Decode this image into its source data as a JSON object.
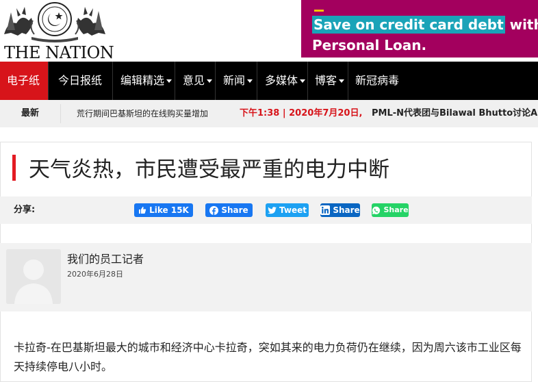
{
  "logo": {
    "text": "THE NATION"
  },
  "ad": {
    "line1_highlight": "Save on credit card debt",
    "line1_rest": " with a",
    "line2": "Personal Loan."
  },
  "nav": {
    "items": [
      {
        "label": "电子纸",
        "active": true,
        "dropdown": false
      },
      {
        "label": "今日报纸",
        "active": false,
        "dropdown": false
      },
      {
        "label": "编辑精选",
        "active": false,
        "dropdown": true
      },
      {
        "label": "意见",
        "active": false,
        "dropdown": true
      },
      {
        "label": "新闻",
        "active": false,
        "dropdown": true
      },
      {
        "label": "多媒体",
        "active": false,
        "dropdown": true
      },
      {
        "label": "博客",
        "active": false,
        "dropdown": true
      },
      {
        "label": "新冠病毒",
        "active": false,
        "dropdown": false
      }
    ]
  },
  "ticker": {
    "label": "最新",
    "item1": "荒行期间巴基斯坦的在线购买量增加",
    "time": "下午1:38 | 2020年7月20日,",
    "item2": "PML-N代表团与Bilawal Bhutto讨论APC问"
  },
  "article": {
    "title": "天气炎热，市民遭受最严重的电力中断",
    "share_label": "分享:",
    "share": {
      "fb_like": "Like 15K",
      "fb_share": "Share",
      "tweet": "Tweet",
      "linkedin": "Share",
      "whatsapp": "Share"
    },
    "author": "我们的员工记者",
    "date": "2020年6月28日",
    "body": "卡拉奇-在巴基斯坦最大的城市和经济中心卡拉奇，突如其来的电力负荷仍在继续，因为周六该市工业区每天持续停电八小时。"
  },
  "colors": {
    "accent_red": "#d7141a",
    "ad_bg": "#a3005e",
    "facebook": "#1877f2",
    "twitter": "#1da1f2",
    "linkedin": "#0a66c2",
    "whatsapp": "#25d366"
  }
}
